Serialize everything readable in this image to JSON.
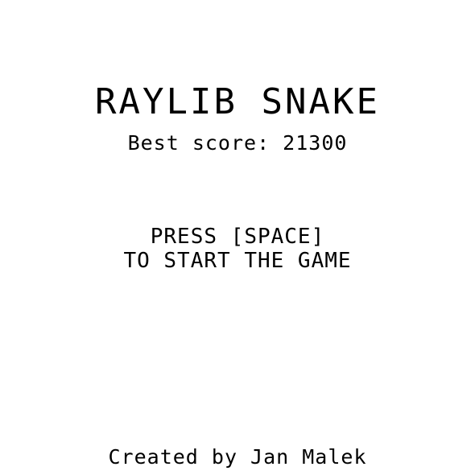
{
  "game": {
    "title": "RAYLIB SNAKE",
    "best_score_text": "Best score: 21300",
    "prompt_line_1": "PRESS [SPACE]",
    "prompt_line_2": "TO START THE GAME",
    "credit": "Created by Jan Malek"
  },
  "colors": {
    "background": "#ffffff",
    "text": "#000000"
  }
}
